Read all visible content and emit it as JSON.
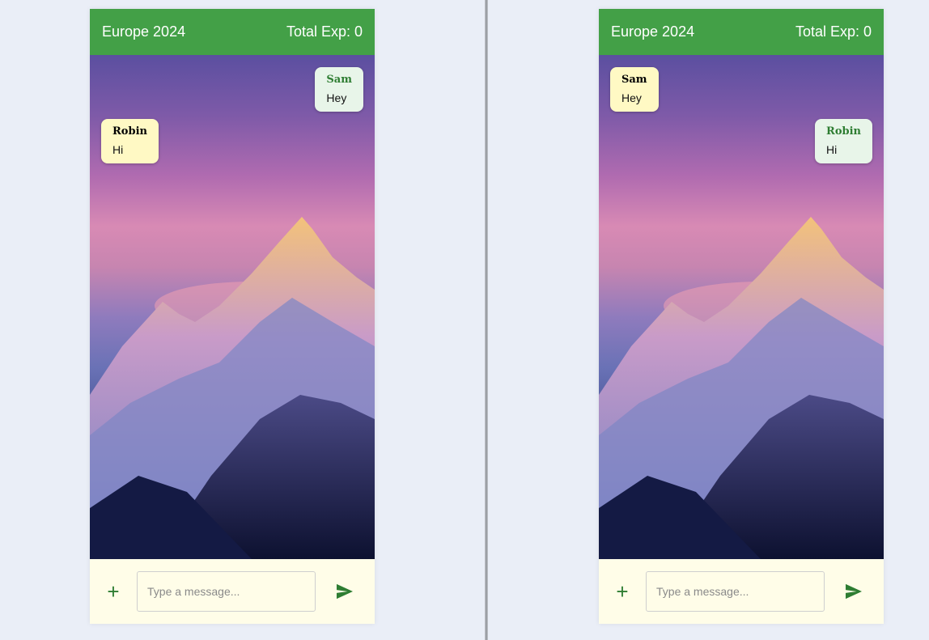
{
  "colors": {
    "header": "#43a047",
    "accent": "#2e7d32",
    "composer_bg": "#fffde8",
    "own_bubble": "#e8f5e9",
    "other_bubble": "#fff9c4"
  },
  "icons": {
    "add": "plus-icon",
    "send": "send-icon"
  },
  "left_view": {
    "header": {
      "title": "Europe 2024",
      "total": "Total Exp: 0"
    },
    "messages": [
      {
        "name": "Sam",
        "text": "Hey"
      },
      {
        "name": "Robin",
        "text": "Hi"
      }
    ],
    "composer": {
      "add_label": "+",
      "placeholder": "Type a message..."
    }
  },
  "right_view": {
    "header": {
      "title": "Europe 2024",
      "total": "Total Exp: 0"
    },
    "messages": [
      {
        "name": "Sam",
        "text": "Hey"
      },
      {
        "name": "Robin",
        "text": "Hi"
      }
    ],
    "composer": {
      "add_label": "+",
      "placeholder": "Type a message..."
    }
  }
}
